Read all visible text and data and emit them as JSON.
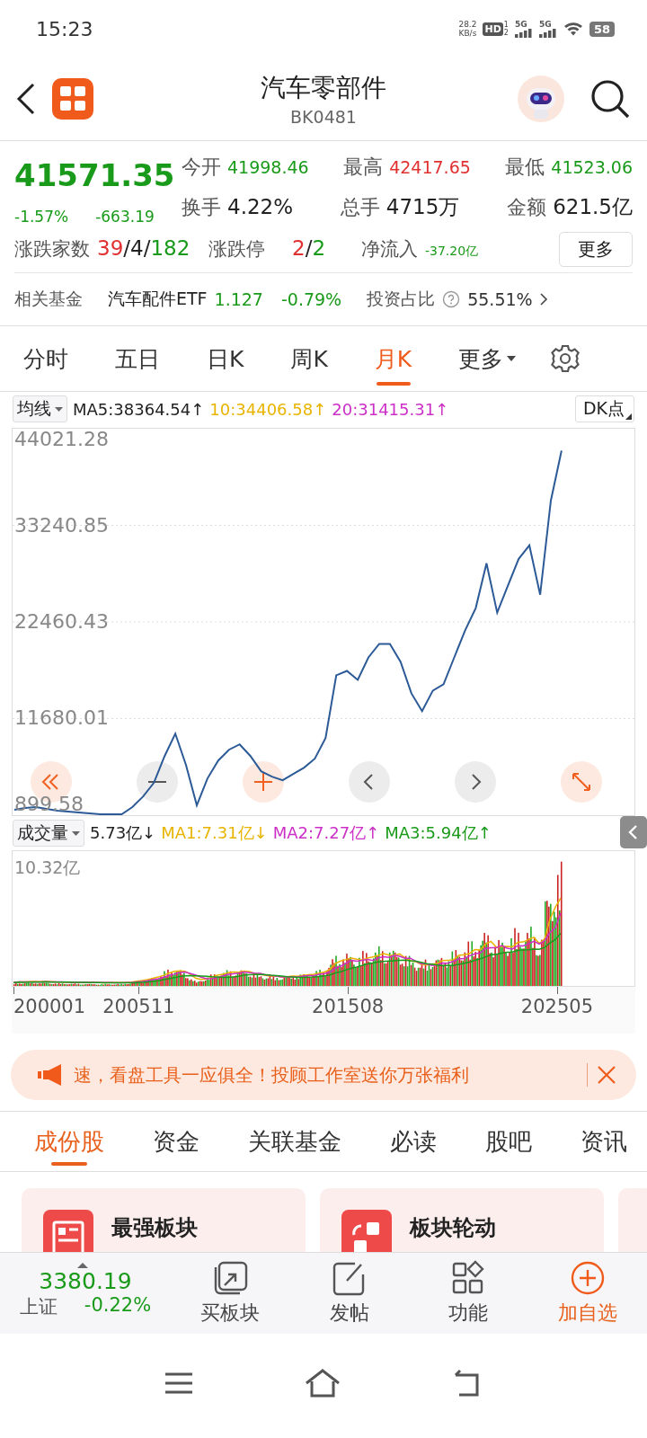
{
  "status_bar": {
    "time": "15:23",
    "net_speed": [
      "28.2",
      "KB/s"
    ],
    "hd_badge": "HD",
    "sim_labels": [
      "1",
      "2"
    ],
    "signals": [
      "5G",
      "5G"
    ],
    "battery": "58"
  },
  "header": {
    "title": "汽车零部件",
    "code": "BK0481"
  },
  "quote": {
    "price": "41571.35",
    "change_pct": "-1.57%",
    "change": "-663.19",
    "color": "#1a9a1a",
    "rows": [
      [
        {
          "label": "今开",
          "value": "41998.46",
          "color": "#1a9a1a"
        },
        {
          "label": "最高",
          "value": "42417.65",
          "color": "#e03030"
        },
        {
          "label": "最低",
          "value": "41523.06",
          "color": "#1a9a1a"
        }
      ],
      [
        {
          "label": "换手",
          "value": "4.22%",
          "color": "#222222"
        },
        {
          "label": "总手",
          "value": "4715万",
          "color": "#222222"
        },
        {
          "label": "金额",
          "value": "621.5亿",
          "color": "#222222"
        }
      ]
    ],
    "breadth": [
      {
        "label": "涨跌家数",
        "parts": [
          {
            "text": "39",
            "color": "#e03030"
          },
          {
            "text": "/",
            "color": "#222222"
          },
          {
            "text": "4",
            "color": "#222222"
          },
          {
            "text": "/",
            "color": "#222222"
          },
          {
            "text": "182",
            "color": "#1a9a1a"
          }
        ]
      },
      {
        "label": "涨跌停",
        "parts": [
          {
            "text": "2",
            "color": "#e03030"
          },
          {
            "text": "/",
            "color": "#222222"
          },
          {
            "text": "2",
            "color": "#1a9a1a"
          }
        ]
      },
      {
        "label": "净流入",
        "parts": [
          {
            "text": "-37.20亿",
            "color": "#1a9a1a"
          }
        ]
      }
    ],
    "more_button": "更多"
  },
  "fund": {
    "label": "相关基金",
    "name": "汽车配件ETF",
    "price": "1.127",
    "change": "-0.79%",
    "color": "#1a9a1a",
    "ratio_label": "投资占比",
    "ratio": "55.51%"
  },
  "period_tabs": [
    {
      "label": "分时",
      "selected": false,
      "dropdown": false
    },
    {
      "label": "五日",
      "selected": false,
      "dropdown": false
    },
    {
      "label": "日K",
      "selected": false,
      "dropdown": false
    },
    {
      "label": "周K",
      "selected": false,
      "dropdown": false
    },
    {
      "label": "月K",
      "selected": true,
      "dropdown": false
    },
    {
      "label": "更多",
      "selected": false,
      "dropdown": true
    }
  ],
  "ma_bar": {
    "selector": "均线",
    "items": [
      {
        "text": "MA5:38364.54↑",
        "color": "#222222"
      },
      {
        "text": "10:34406.58↑",
        "color": "#e8b400"
      },
      {
        "text": "20:31415.31↑",
        "color": "#cc2fc6"
      }
    ],
    "dk_button": "DK点"
  },
  "price_chart": {
    "chart_data": {
      "type": "line",
      "grid": true,
      "ylim": [
        899.58,
        44021.28
      ],
      "yticks": [
        899.58,
        11680.01,
        22460.43,
        33240.85,
        44021.28
      ],
      "series": [
        {
          "color": "#2c5a96",
          "values": [
            1500,
            1700,
            1800,
            1600,
            1400,
            1300,
            1200,
            1100,
            1000,
            1000,
            1000,
            1800,
            3000,
            4500,
            7500,
            10000,
            6500,
            2000,
            5000,
            7000,
            8200,
            8800,
            7500,
            5800,
            5200,
            4800,
            5500,
            6200,
            7200,
            9500,
            16500,
            17000,
            16000,
            18500,
            20000,
            20000,
            18000,
            14500,
            12500,
            14800,
            15500,
            18500,
            21500,
            24000,
            29000,
            23500,
            26500,
            29500,
            31000,
            25500,
            36000,
            41571
          ]
        }
      ]
    }
  },
  "volume": {
    "selector": "成交量",
    "items": [
      {
        "text": "5.73亿↓",
        "color": "#222222"
      },
      {
        "text": "MA1:7.31亿↓",
        "color": "#e8b400"
      },
      {
        "text": "MA2:7.27亿↑",
        "color": "#cc2fc6"
      },
      {
        "text": "MA3:5.94亿↑",
        "color": "#1a9a1a"
      }
    ],
    "max_label": "10.32亿",
    "x_labels": [
      "200001",
      "200511",
      "201508",
      "202505"
    ]
  },
  "banner": {
    "text": "速，看盘工具一应俱全！投顾工作室送你万张福利"
  },
  "content_tabs": [
    {
      "label": "成份股",
      "selected": true
    },
    {
      "label": "资金",
      "selected": false
    },
    {
      "label": "关联基金",
      "selected": false
    },
    {
      "label": "必读",
      "selected": false
    },
    {
      "label": "股吧",
      "selected": false
    },
    {
      "label": "资讯",
      "selected": false
    }
  ],
  "cards": [
    {
      "title": "最强板块",
      "kind": "chart"
    },
    {
      "title": "板块轮动",
      "kind": "rotate"
    }
  ],
  "bottom_bar": {
    "index": {
      "value": "3380.19",
      "name": "上证",
      "change": "-0.22%",
      "color": "#1a9a1a"
    },
    "actions": [
      {
        "label": "买板块",
        "kind": "buy"
      },
      {
        "label": "发帖",
        "kind": "post"
      },
      {
        "label": "功能",
        "kind": "tools"
      },
      {
        "label": "加自选",
        "kind": "add"
      }
    ]
  }
}
